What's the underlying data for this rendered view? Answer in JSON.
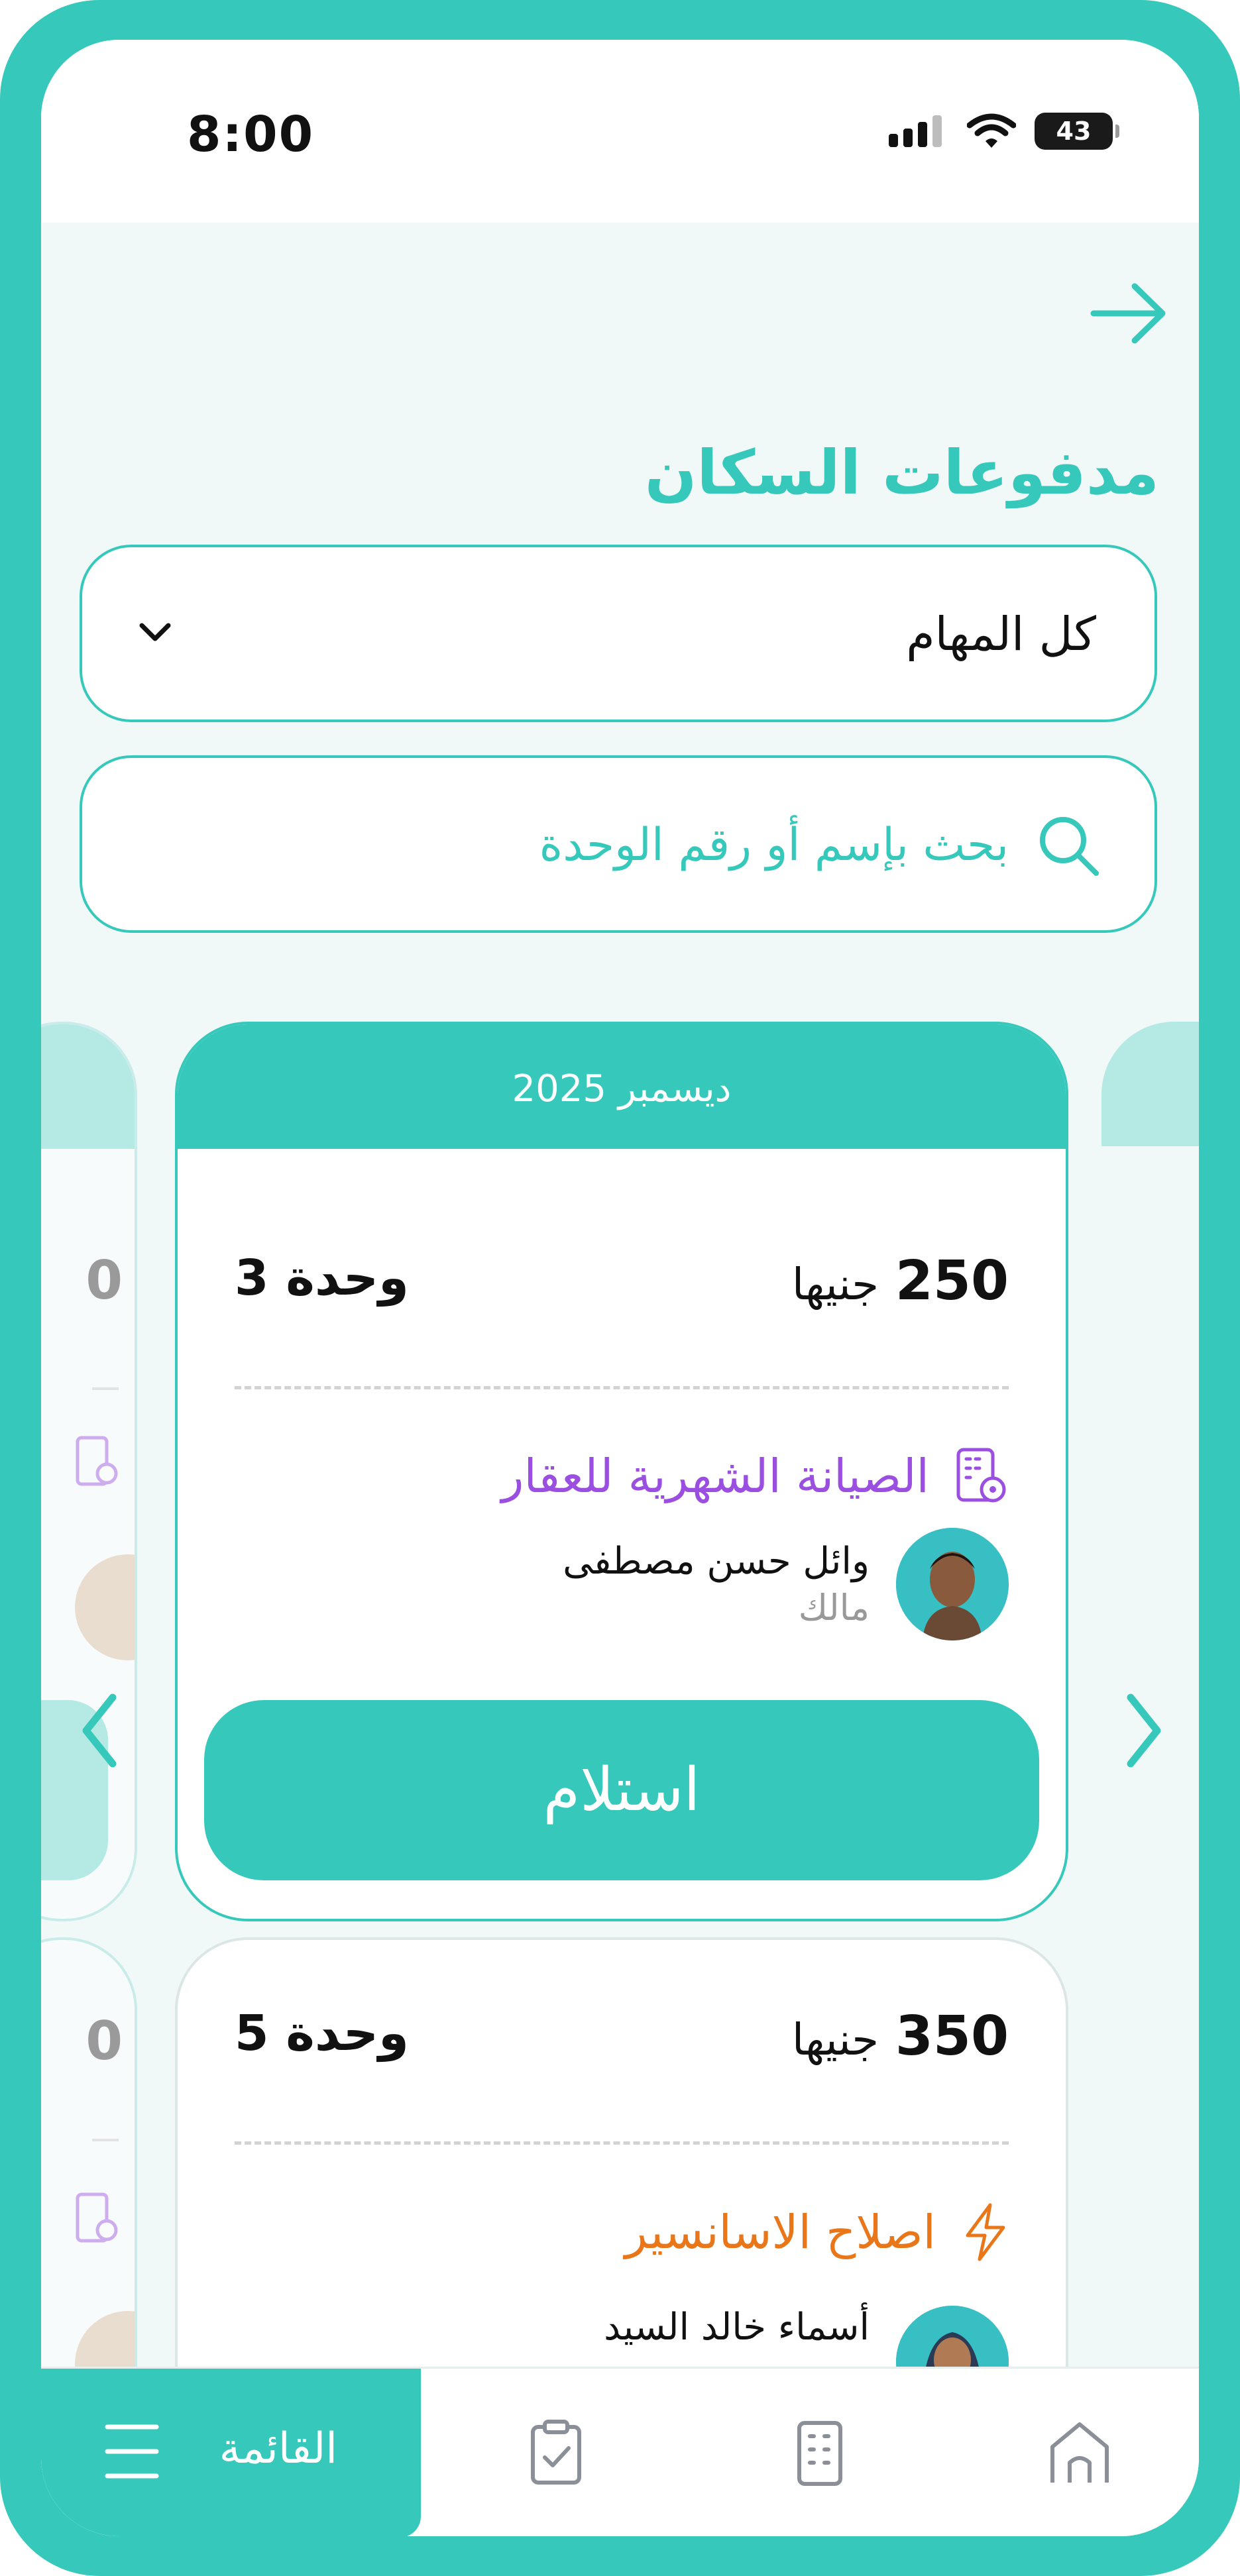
{
  "status_bar": {
    "time": "8:00",
    "battery": "43"
  },
  "header": {
    "title": "مدفوعات السكان"
  },
  "filter": {
    "selected": "كل المهام"
  },
  "search": {
    "placeholder": "بحث بإسم أو رقم الوحدة"
  },
  "payments": [
    {
      "month": "ديسمبر 2025",
      "amount": "250",
      "currency": "جنيها",
      "unit": "وحدة 3",
      "service": "الصيانة الشهرية للعقار",
      "service_color": "#9b4fe0",
      "service_icon": "building-gear-icon",
      "resident_name": "وائل حسن مصطفى",
      "resident_role": "مالك",
      "action": "استلام"
    },
    {
      "amount": "350",
      "currency": "جنيها",
      "unit": "وحدة 5",
      "service": "اصلاح الاسانسير",
      "service_color": "#e9771a",
      "service_icon": "lightning-icon",
      "resident_name": "أسماء خالد السيد"
    }
  ],
  "side_cards": {
    "left_amount_fragment": "0",
    "left_amount_fragment_2": "0"
  },
  "bottom_nav": {
    "menu_label": "القائمة",
    "items": [
      "tasks-icon",
      "building-icon",
      "home-icon"
    ]
  },
  "colors": {
    "primary": "#36c9bb",
    "purple": "#9b4fe0",
    "orange": "#e9771a"
  }
}
